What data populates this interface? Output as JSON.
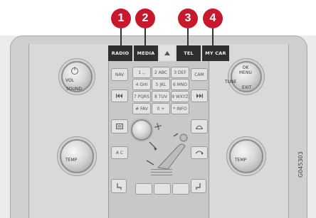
{
  "callouts": [
    "1",
    "2",
    "3",
    "4"
  ],
  "top_buttons": {
    "radio": "RADIO",
    "media": "MEDIA",
    "tel": "TEL",
    "mycar": "MY CAR"
  },
  "knob_labels": {
    "vol": "VOL",
    "sound": "SOUND",
    "ok_menu": "OK\nMENU",
    "tune": "TUNE",
    "exit": "EXIT",
    "temp_left": "TEMP",
    "temp_right": "TEMP"
  },
  "side_labels": {
    "nav": "NAV",
    "cam": "CAM",
    "ac": "A C"
  },
  "keypad": [
    "1 .,",
    "2 ABC",
    "3 DEF",
    "4 GHI",
    "5 JKL",
    "6 MNO",
    "7 PQRS",
    "8 TUV",
    "9 WXYZ",
    "# FAV",
    "0 +",
    "* INFO"
  ],
  "figure_code": "G045303",
  "icons": [
    "up-arrow-icon",
    "prev-track-icon",
    "next-track-icon",
    "rear-defrost-icon",
    "front-defrost-icon",
    "recirculation-icon",
    "fan-icon",
    "seat-heater-icon"
  ]
}
